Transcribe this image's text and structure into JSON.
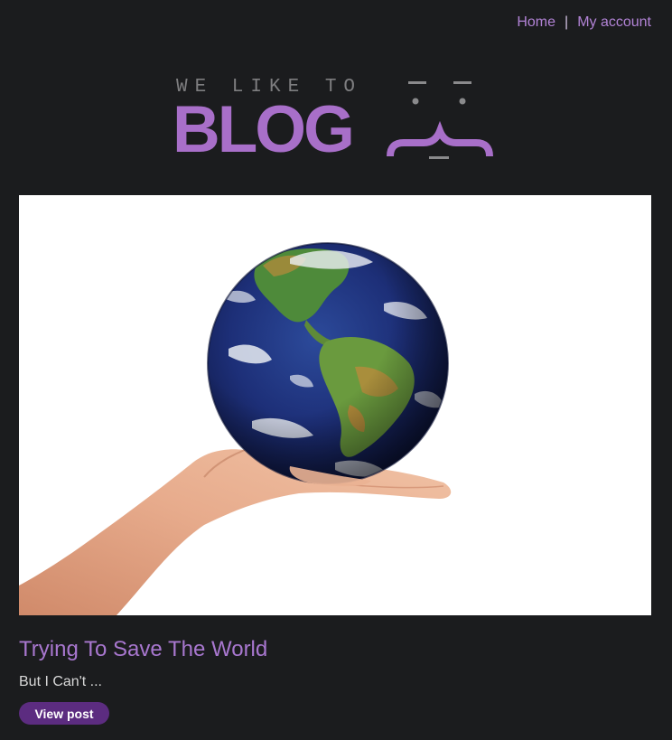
{
  "nav": {
    "home_label": "Home",
    "separator": "|",
    "account_label": "My account"
  },
  "logo": {
    "tagline": "WE LIKE TO",
    "wordmark": "BLOG",
    "icon": "curly-brace-face-icon",
    "colors": {
      "wordmark": "#a86fc9",
      "tagline": "#7e7e80"
    }
  },
  "post": {
    "image": "earth-globe-on-hand-image",
    "title": "Trying To Save The World",
    "summary": "But I Can't ...",
    "button_label": "View post"
  },
  "colors": {
    "background": "#1b1c1e",
    "accent": "#a877cf",
    "button": "#5c2c80"
  }
}
